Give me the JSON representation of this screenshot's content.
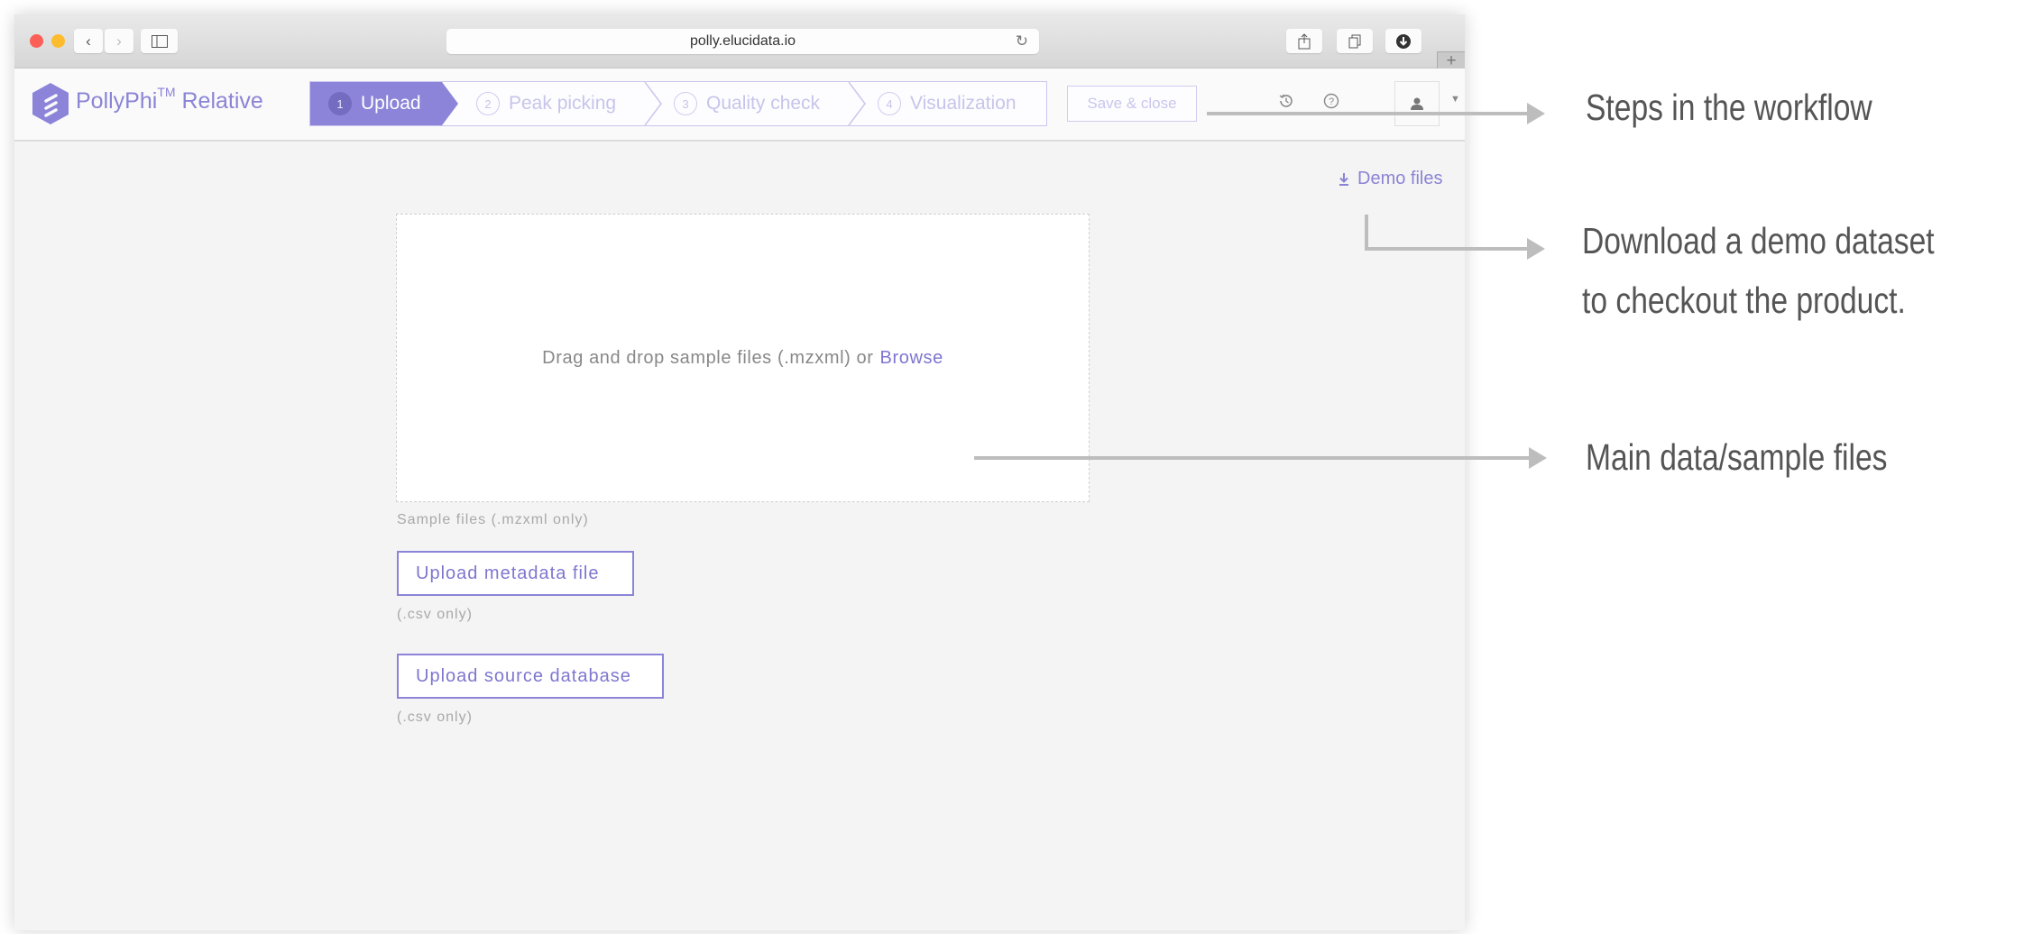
{
  "browser": {
    "url": "polly.elucidata.io",
    "icons": {
      "back": "chevron-left-icon",
      "forward": "chevron-right-icon",
      "sidebar": "sidebar-icon",
      "reload": "reload-icon",
      "share": "share-icon",
      "tabs": "tabs-icon",
      "downloads": "download-icon",
      "new_tab": "plus-icon"
    }
  },
  "app": {
    "brand_name": "PollyPhi",
    "brand_tm": "TM",
    "brand_suffix": "Relative",
    "accent_color": "#8b84d8",
    "steps": [
      {
        "number": "1",
        "label": "Upload",
        "active": true
      },
      {
        "number": "2",
        "label": "Peak picking",
        "active": false
      },
      {
        "number": "3",
        "label": "Quality check",
        "active": false
      },
      {
        "number": "4",
        "label": "Visualization",
        "active": false
      }
    ],
    "save_close_label": "Save & close",
    "header_icons": [
      "history-icon",
      "help-icon",
      "user-icon",
      "caret-down-icon"
    ]
  },
  "main": {
    "demo_files_label": "Demo files",
    "dropzone_text": "Drag and drop sample files (.mzxml) or",
    "dropzone_link": "Browse",
    "sample_hint": "Sample files (.mzxml only)",
    "metadata_button": "Upload metadata file",
    "metadata_hint": "(.csv only)",
    "source_db_button": "Upload source database",
    "source_db_hint": "(.csv only)"
  },
  "annotations": [
    {
      "text": "Steps in the workflow"
    },
    {
      "text": "Download a demo dataset"
    },
    {
      "text": "to checkout the product."
    },
    {
      "text": "Main data/sample files"
    }
  ]
}
